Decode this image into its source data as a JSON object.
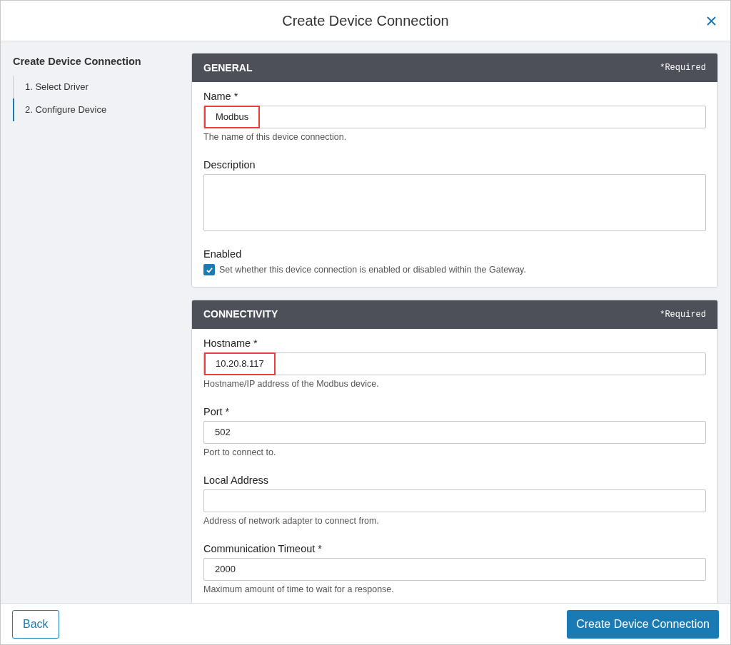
{
  "dialog": {
    "title": "Create Device Connection"
  },
  "steps": {
    "title": "Create Device Connection",
    "items": [
      {
        "label": "1. Select Driver",
        "selected": false
      },
      {
        "label": "2. Configure Device",
        "selected": true
      }
    ]
  },
  "sections": [
    {
      "title": "GENERAL",
      "required_note": "*Required",
      "fields": [
        {
          "kind": "text",
          "label": "Name *",
          "value": "Modbus",
          "highlighted": true,
          "hint": "The name of this device connection."
        },
        {
          "kind": "textarea",
          "label": "Description"
        },
        {
          "kind": "checkbox",
          "label": "Enabled",
          "checked": true,
          "hint": "Set whether this device connection is enabled or disabled within the Gateway."
        }
      ]
    },
    {
      "title": "CONNECTIVITY",
      "required_note": "*Required",
      "fields": [
        {
          "kind": "text",
          "label": "Hostname *",
          "value": "10.20.8.117",
          "highlighted": true,
          "hint": "Hostname/IP address of the Modbus device."
        },
        {
          "kind": "text",
          "label": "Port *",
          "value": "502",
          "hint": "Port to connect to."
        },
        {
          "kind": "text",
          "label": "Local Address",
          "hint": "Address of network adapter to connect from."
        },
        {
          "kind": "text",
          "label": "Communication Timeout *",
          "value": "2000",
          "hint": "Maximum amount of time to wait for a response."
        }
      ]
    }
  ],
  "footer": {
    "back": "Back",
    "submit": "Create Device Connection"
  }
}
